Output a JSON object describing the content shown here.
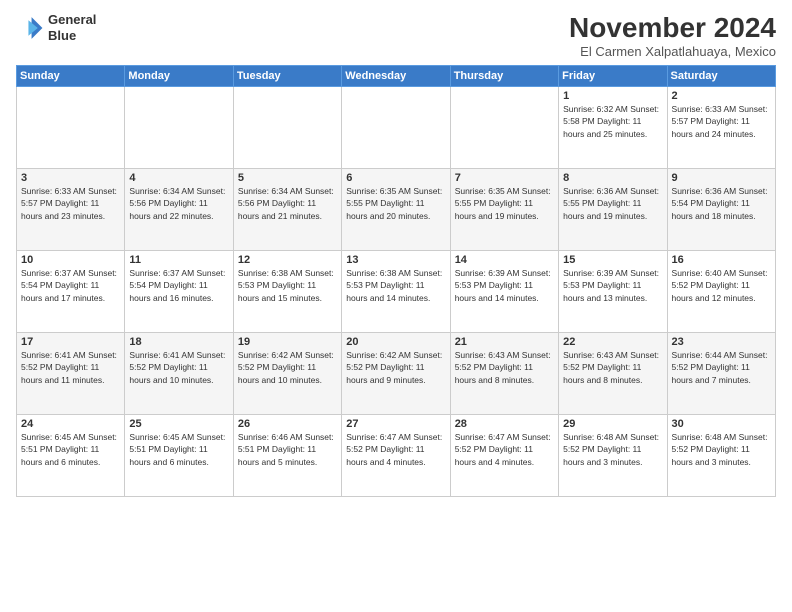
{
  "header": {
    "logo_line1": "General",
    "logo_line2": "Blue",
    "month": "November 2024",
    "location": "El Carmen Xalpatlahuaya, Mexico"
  },
  "weekdays": [
    "Sunday",
    "Monday",
    "Tuesday",
    "Wednesday",
    "Thursday",
    "Friday",
    "Saturday"
  ],
  "weeks": [
    [
      {
        "day": "",
        "info": ""
      },
      {
        "day": "",
        "info": ""
      },
      {
        "day": "",
        "info": ""
      },
      {
        "day": "",
        "info": ""
      },
      {
        "day": "",
        "info": ""
      },
      {
        "day": "1",
        "info": "Sunrise: 6:32 AM\nSunset: 5:58 PM\nDaylight: 11 hours and 25 minutes."
      },
      {
        "day": "2",
        "info": "Sunrise: 6:33 AM\nSunset: 5:57 PM\nDaylight: 11 hours and 24 minutes."
      }
    ],
    [
      {
        "day": "3",
        "info": "Sunrise: 6:33 AM\nSunset: 5:57 PM\nDaylight: 11 hours and 23 minutes."
      },
      {
        "day": "4",
        "info": "Sunrise: 6:34 AM\nSunset: 5:56 PM\nDaylight: 11 hours and 22 minutes."
      },
      {
        "day": "5",
        "info": "Sunrise: 6:34 AM\nSunset: 5:56 PM\nDaylight: 11 hours and 21 minutes."
      },
      {
        "day": "6",
        "info": "Sunrise: 6:35 AM\nSunset: 5:55 PM\nDaylight: 11 hours and 20 minutes."
      },
      {
        "day": "7",
        "info": "Sunrise: 6:35 AM\nSunset: 5:55 PM\nDaylight: 11 hours and 19 minutes."
      },
      {
        "day": "8",
        "info": "Sunrise: 6:36 AM\nSunset: 5:55 PM\nDaylight: 11 hours and 19 minutes."
      },
      {
        "day": "9",
        "info": "Sunrise: 6:36 AM\nSunset: 5:54 PM\nDaylight: 11 hours and 18 minutes."
      }
    ],
    [
      {
        "day": "10",
        "info": "Sunrise: 6:37 AM\nSunset: 5:54 PM\nDaylight: 11 hours and 17 minutes."
      },
      {
        "day": "11",
        "info": "Sunrise: 6:37 AM\nSunset: 5:54 PM\nDaylight: 11 hours and 16 minutes."
      },
      {
        "day": "12",
        "info": "Sunrise: 6:38 AM\nSunset: 5:53 PM\nDaylight: 11 hours and 15 minutes."
      },
      {
        "day": "13",
        "info": "Sunrise: 6:38 AM\nSunset: 5:53 PM\nDaylight: 11 hours and 14 minutes."
      },
      {
        "day": "14",
        "info": "Sunrise: 6:39 AM\nSunset: 5:53 PM\nDaylight: 11 hours and 14 minutes."
      },
      {
        "day": "15",
        "info": "Sunrise: 6:39 AM\nSunset: 5:53 PM\nDaylight: 11 hours and 13 minutes."
      },
      {
        "day": "16",
        "info": "Sunrise: 6:40 AM\nSunset: 5:52 PM\nDaylight: 11 hours and 12 minutes."
      }
    ],
    [
      {
        "day": "17",
        "info": "Sunrise: 6:41 AM\nSunset: 5:52 PM\nDaylight: 11 hours and 11 minutes."
      },
      {
        "day": "18",
        "info": "Sunrise: 6:41 AM\nSunset: 5:52 PM\nDaylight: 11 hours and 10 minutes."
      },
      {
        "day": "19",
        "info": "Sunrise: 6:42 AM\nSunset: 5:52 PM\nDaylight: 11 hours and 10 minutes."
      },
      {
        "day": "20",
        "info": "Sunrise: 6:42 AM\nSunset: 5:52 PM\nDaylight: 11 hours and 9 minutes."
      },
      {
        "day": "21",
        "info": "Sunrise: 6:43 AM\nSunset: 5:52 PM\nDaylight: 11 hours and 8 minutes."
      },
      {
        "day": "22",
        "info": "Sunrise: 6:43 AM\nSunset: 5:52 PM\nDaylight: 11 hours and 8 minutes."
      },
      {
        "day": "23",
        "info": "Sunrise: 6:44 AM\nSunset: 5:52 PM\nDaylight: 11 hours and 7 minutes."
      }
    ],
    [
      {
        "day": "24",
        "info": "Sunrise: 6:45 AM\nSunset: 5:51 PM\nDaylight: 11 hours and 6 minutes."
      },
      {
        "day": "25",
        "info": "Sunrise: 6:45 AM\nSunset: 5:51 PM\nDaylight: 11 hours and 6 minutes."
      },
      {
        "day": "26",
        "info": "Sunrise: 6:46 AM\nSunset: 5:51 PM\nDaylight: 11 hours and 5 minutes."
      },
      {
        "day": "27",
        "info": "Sunrise: 6:47 AM\nSunset: 5:52 PM\nDaylight: 11 hours and 4 minutes."
      },
      {
        "day": "28",
        "info": "Sunrise: 6:47 AM\nSunset: 5:52 PM\nDaylight: 11 hours and 4 minutes."
      },
      {
        "day": "29",
        "info": "Sunrise: 6:48 AM\nSunset: 5:52 PM\nDaylight: 11 hours and 3 minutes."
      },
      {
        "day": "30",
        "info": "Sunrise: 6:48 AM\nSunset: 5:52 PM\nDaylight: 11 hours and 3 minutes."
      }
    ]
  ]
}
